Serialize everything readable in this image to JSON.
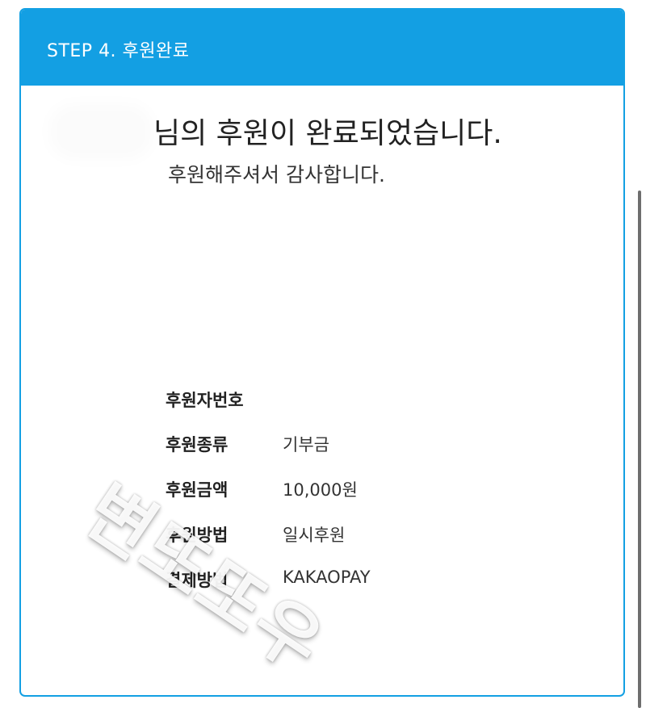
{
  "header": {
    "title": "STEP 4. 후원완료"
  },
  "message": {
    "headline": "님의 후원이 완료되었습니다.",
    "subline": "후원해주셔서 감사합니다."
  },
  "details": [
    {
      "label": "후원자번호",
      "value": ""
    },
    {
      "label": "후원종류",
      "value": "기부금"
    },
    {
      "label": "후원금액",
      "value": "10,000원"
    },
    {
      "label": "후원방법",
      "value": "일시후원"
    },
    {
      "label": "결제방법",
      "value": "KAKAOPAY"
    }
  ],
  "watermark": {
    "text": "변또또우"
  },
  "colors": {
    "accent": "#139fe3",
    "border": "#13a0e3"
  }
}
